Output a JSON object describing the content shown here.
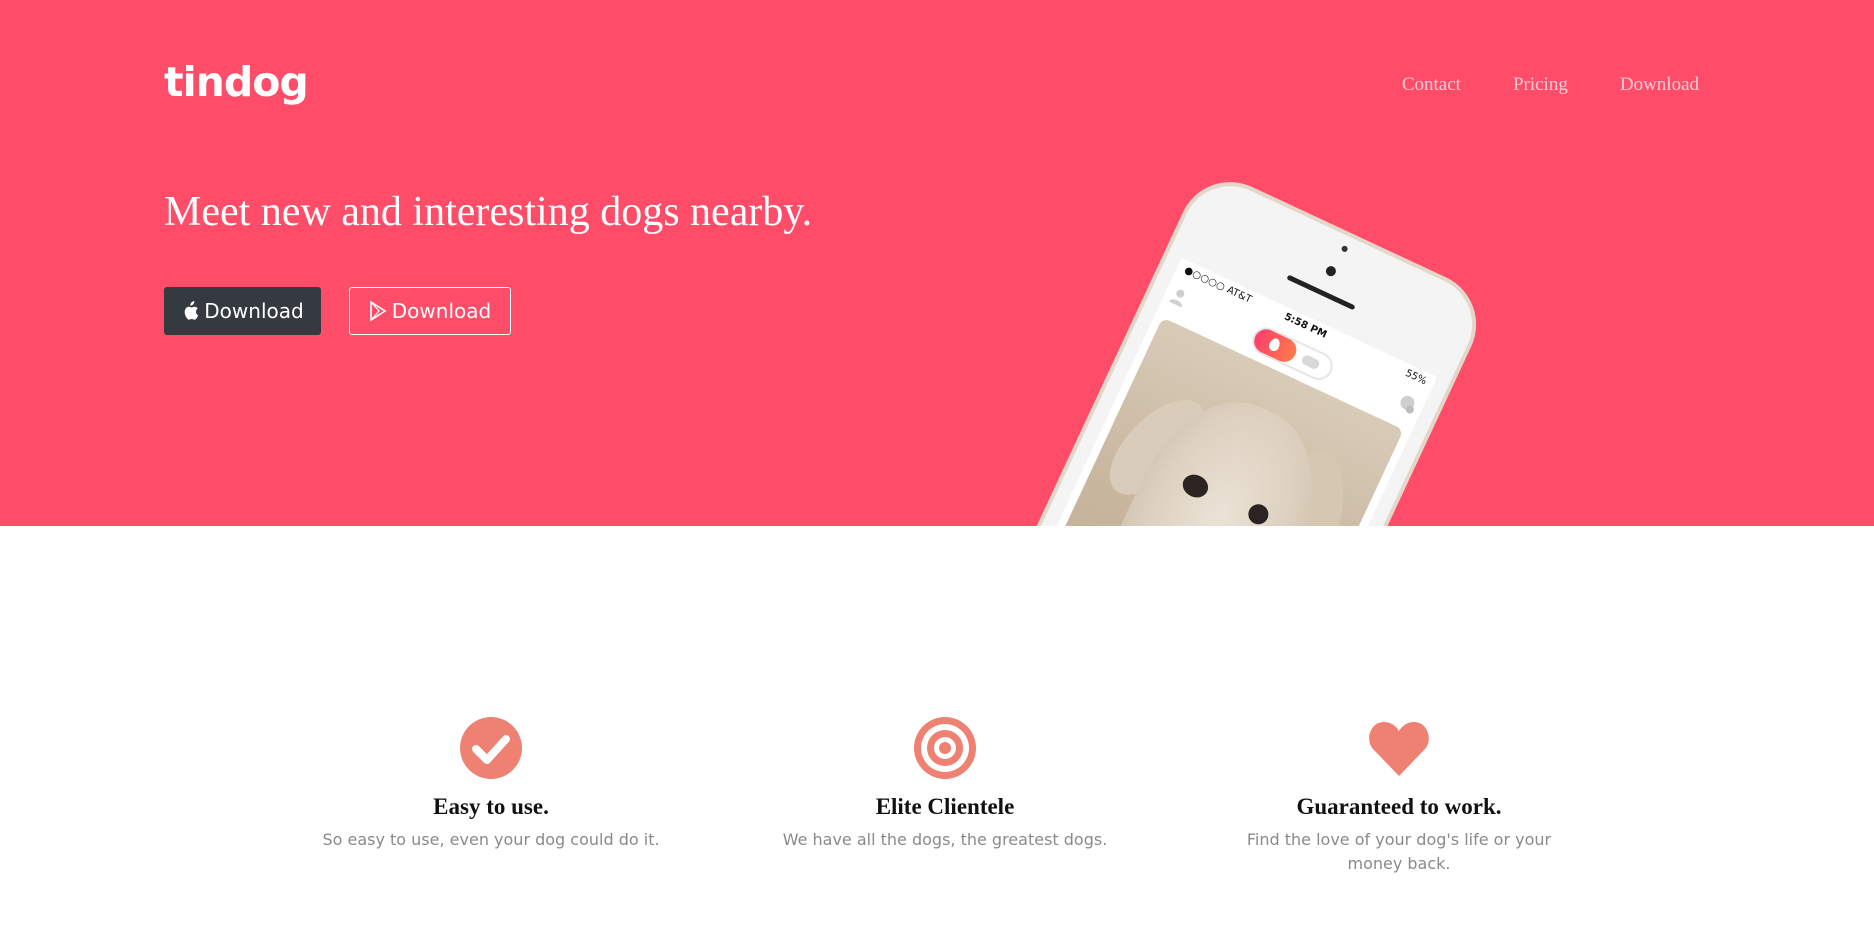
{
  "header": {
    "brand": "tindog",
    "nav": [
      "Contact",
      "Pricing",
      "Download"
    ]
  },
  "hero": {
    "headline": "Meet new and interesting dogs nearby.",
    "apple_button": "Download",
    "play_button": "Download",
    "phone": {
      "carrier": "●○○○○ AT&T",
      "time": "5:58 PM",
      "battery": "55%"
    }
  },
  "features": [
    {
      "icon": "check-circle-icon",
      "title": "Easy to use.",
      "text": "So easy to use, even your dog could do it."
    },
    {
      "icon": "target-icon",
      "title": "Elite Clientele",
      "text": "We have all the dogs, the greatest dogs."
    },
    {
      "icon": "heart-icon",
      "title": "Guaranteed to work.",
      "text": "Find the love of your dog's life or your money back."
    }
  ],
  "colors": {
    "hero_bg": "#ff4c68",
    "dark_button": "#343a40",
    "icon_accent": "#ef8172"
  }
}
